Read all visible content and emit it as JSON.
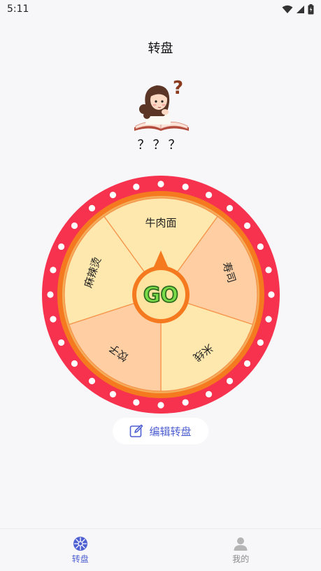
{
  "status_bar": {
    "time": "5:11"
  },
  "header": {
    "title": "转盘"
  },
  "result": {
    "text": "？？？"
  },
  "wheel": {
    "segments": [
      "牛肉面",
      "寿司",
      "米线",
      "饺子",
      "麻辣烫"
    ],
    "center_label": "GO",
    "colors": {
      "outer_ring": "#f7324e",
      "inner_ring": "#f57a1f",
      "segment_light": "#ffe8ad",
      "segment_dark": "#ffcfa3",
      "center_fill": "#ffe3a0",
      "center_text": "#7bdc4a"
    }
  },
  "edit_button": {
    "label": "编辑转盘",
    "icon": "edit-icon"
  },
  "bottom_nav": {
    "items": [
      {
        "label": "转盘",
        "icon": "wheel-icon",
        "active": true
      },
      {
        "label": "我的",
        "icon": "person-icon",
        "active": false
      }
    ],
    "accent": "#4e5fd1"
  }
}
